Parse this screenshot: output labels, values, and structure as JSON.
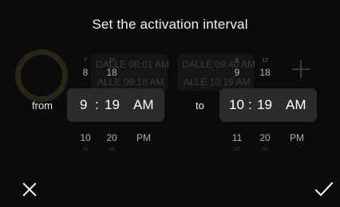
{
  "title": "Set the activation interval",
  "background": {
    "card_left": {
      "line1": "DALLE 08:01 AM",
      "line2": "ALLE 09:18 AM"
    },
    "card_right": {
      "line1": "DALLE 09:40 AM",
      "line2": "ALLE 10:19 AM"
    }
  },
  "from": {
    "label": "from",
    "hour": "9",
    "separator": ":",
    "minute": "19",
    "ampm": "AM",
    "above": {
      "hour": "8",
      "minute": "18",
      "hour_2": "7",
      "minute_2": "17"
    },
    "below": {
      "hour": "10",
      "minute": "20",
      "ampm": "PM",
      "hour_2": "11",
      "minute_2": "21"
    }
  },
  "to": {
    "label": "to",
    "hour": "10",
    "separator": ":",
    "minute": "19",
    "ampm": "AM",
    "above": {
      "hour": "9",
      "minute": "18",
      "hour_2": "8",
      "minute_2": "17"
    },
    "below": {
      "hour": "11",
      "minute": "20",
      "ampm": "PM",
      "hour_2": "12",
      "minute_2": "21"
    }
  },
  "icons": {
    "cancel": "close-icon",
    "confirm": "check-icon"
  }
}
